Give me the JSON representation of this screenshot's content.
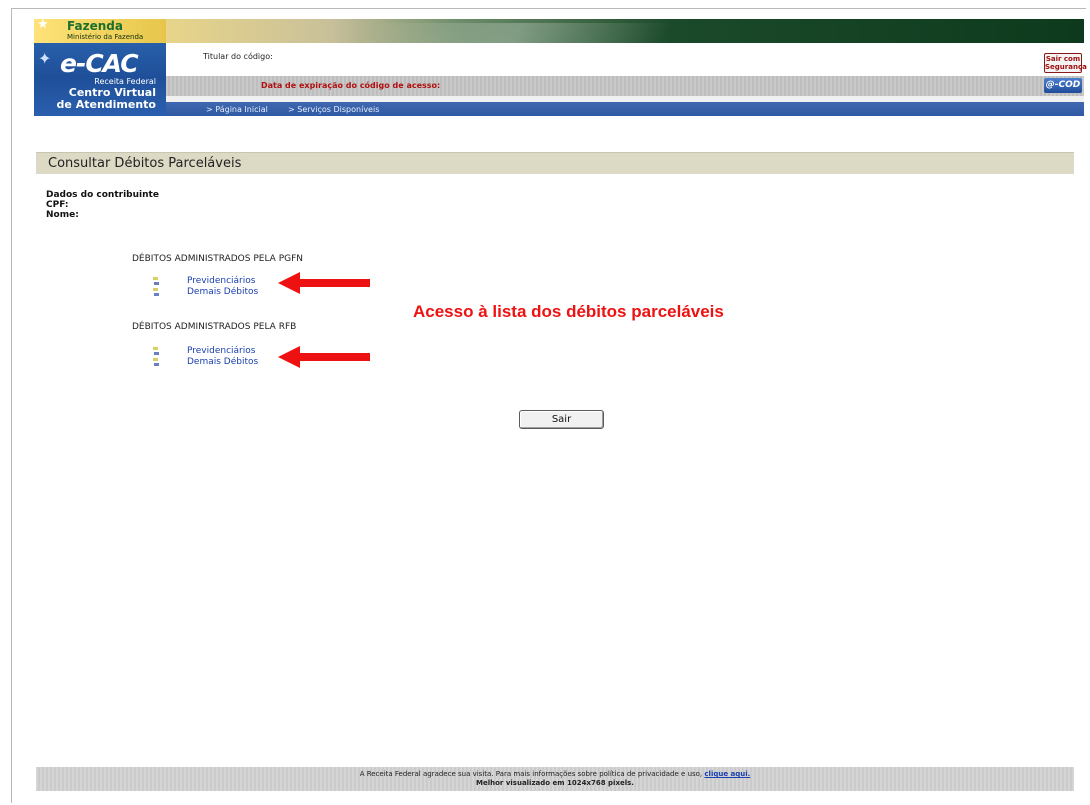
{
  "header": {
    "logo_org": "Fazenda",
    "logo_ministry": "Ministério da Fazenda",
    "logo_brand": "e-CAC",
    "logo_agency": "Receita Federal",
    "logo_tagline_1": "Centro Virtual",
    "logo_tagline_2": "de Atendimento",
    "titular_label": "Titular do código:",
    "expiration_label": "Data de expiração do código de acesso:",
    "logout_button": "Sair com Segurança",
    "ecod_badge": "@-COD",
    "nav": [
      "> Página Inicial",
      "> Serviços Disponíveis"
    ]
  },
  "page": {
    "section_title": "Consultar Débitos Parceláveis",
    "taxpayer_heading": "Dados do contribuinte",
    "cpf_label": "CPF:",
    "name_label": "Nome:"
  },
  "groups": [
    {
      "title": "DÉBITOS ADMINISTRADOS PELA PGFN",
      "links": [
        "Previdenciários",
        "Demais Débitos"
      ]
    },
    {
      "title": "DÉBITOS ADMINISTRADOS PELA RFB",
      "links": [
        "Previdenciários",
        "Demais Débitos"
      ]
    }
  ],
  "annotation": "Acesso à lista dos débitos parceláveis",
  "exit_button": "Sair",
  "footer": {
    "text": "A Receita Federal agradece sua visita. Para mais informações sobre política de privacidade e uso,",
    "link": "clique aqui.",
    "best_view": "Melhor visualizado em 1024x768 pixels."
  },
  "colors": {
    "annotation": "#ee1111",
    "link": "#1a3fae",
    "nav_bar": "#2f5aa4",
    "section_bg": "#dcd9c4"
  }
}
